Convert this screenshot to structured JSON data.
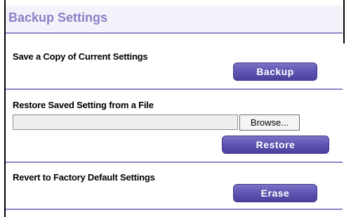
{
  "page": {
    "title": "Backup Settings"
  },
  "sections": {
    "backup": {
      "label": "Save a Copy of Current Settings",
      "button_label": "Backup"
    },
    "restore": {
      "label": "Restore Saved Setting from a File",
      "file_input_value": "",
      "browse_label": "Browse...",
      "button_label": "Restore"
    },
    "erase": {
      "label": "Revert to Factory Default Settings",
      "button_label": "Erase"
    }
  },
  "colors": {
    "title_text": "#8c7fc5",
    "rule": "#8d85c9",
    "button": "#5f57b3"
  }
}
